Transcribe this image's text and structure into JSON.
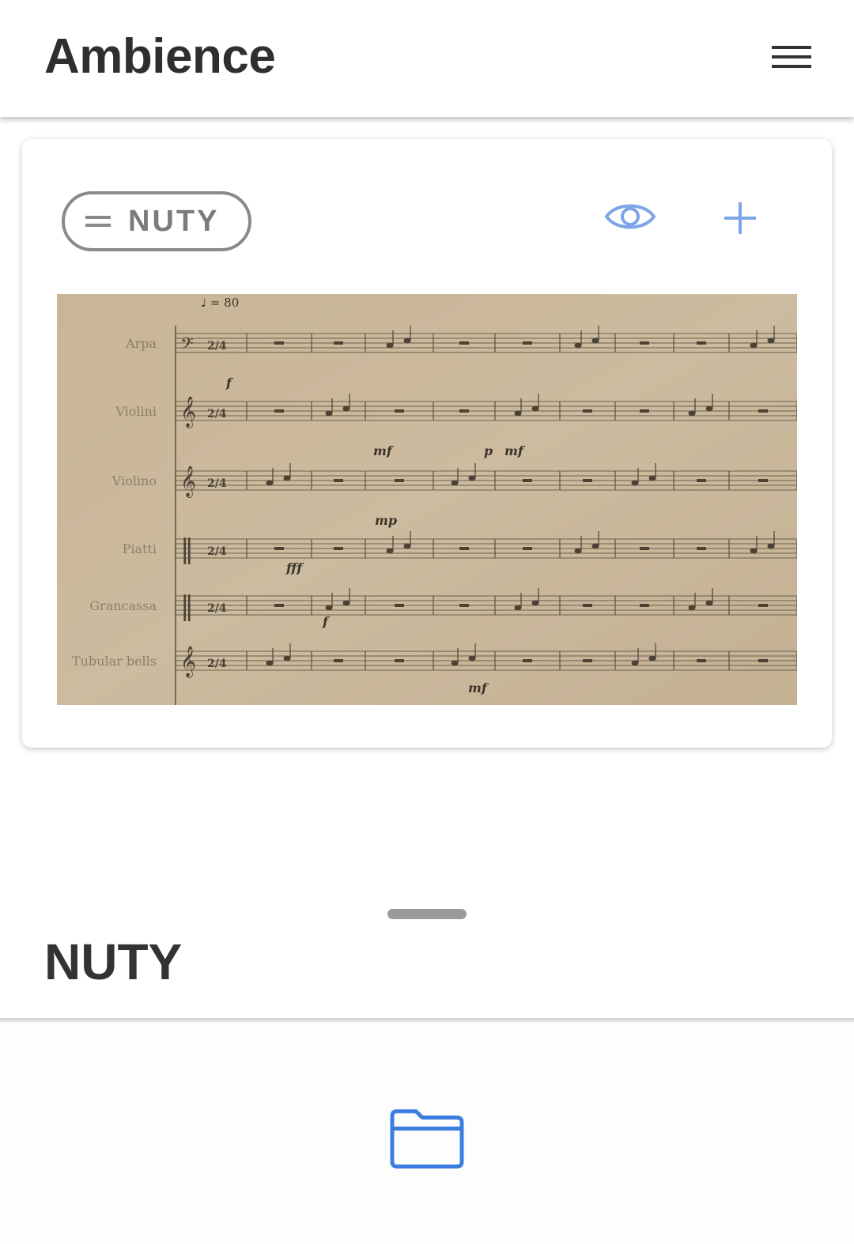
{
  "header": {
    "title": "Ambience",
    "menu_icon": "hamburger-menu-icon"
  },
  "card": {
    "chip_label": "NUTY",
    "chip_icon": "drag-handle-icon",
    "view_icon": "eye-icon",
    "add_icon": "plus-icon",
    "accent_color": "#7ea5e8"
  },
  "score": {
    "tempo": "♩ = 80",
    "instruments": [
      "Arpa",
      "Violini",
      "Violino",
      "Piatti",
      "Grancassa",
      "Tubular bells"
    ],
    "dynamics": [
      "f",
      "mf",
      "p",
      "mf",
      "mp",
      "fff",
      "f",
      "mf"
    ]
  },
  "sheet": {
    "title": "NUTY"
  },
  "bottom_nav": {
    "folder_icon": "folder-icon",
    "accent_color": "#3b7de0"
  }
}
